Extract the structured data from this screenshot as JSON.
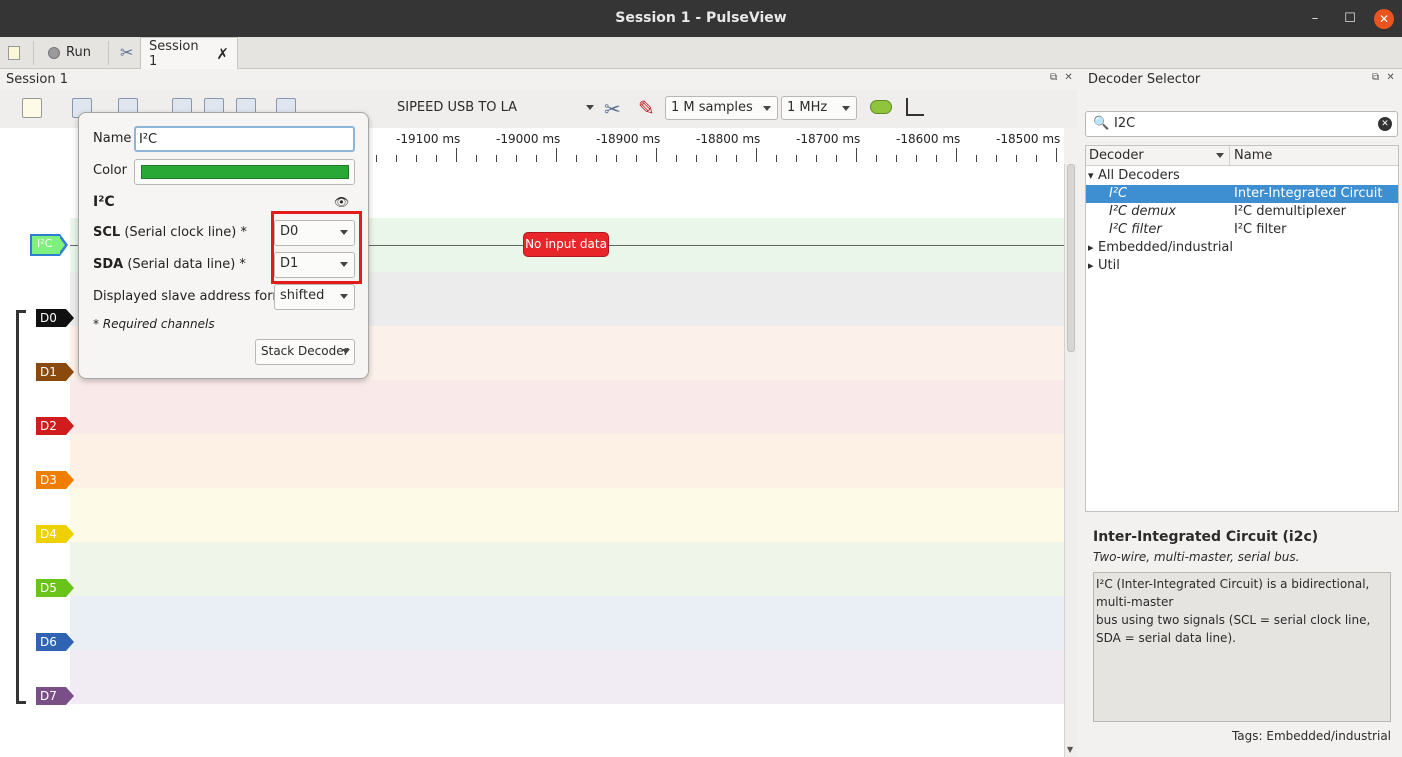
{
  "window": {
    "title": "Session 1 - PulseView",
    "min": "–",
    "max": "☐",
    "close": "✕"
  },
  "tabbar": {
    "run_label": "Run",
    "session_tab": "Session 1",
    "session_close": "✗"
  },
  "session_pane": {
    "title": "Session 1"
  },
  "toolbar": {
    "device": "SIPEED USB TO LA",
    "samples": "1 M samples",
    "rate": "1 MHz"
  },
  "ruler": {
    "ticks": [
      "-19100 ms",
      "-19000 ms",
      "-18900 ms",
      "-18800 ms",
      "-18700 ms",
      "-18600 ms",
      "-18500 ms"
    ]
  },
  "decoder_trace": {
    "label": "I²C",
    "message": "No input data"
  },
  "channels": [
    {
      "label": "D0",
      "color": "#101010",
      "lane": "#ececec"
    },
    {
      "label": "D1",
      "color": "#8a4a0d",
      "lane": "#fbf1ea"
    },
    {
      "label": "D2",
      "color": "#d01c1c",
      "lane": "#fae9e9"
    },
    {
      "label": "D3",
      "color": "#f07d00",
      "lane": "#fdf0e4"
    },
    {
      "label": "D4",
      "color": "#eed000",
      "lane": "#fdfbe8"
    },
    {
      "label": "D5",
      "color": "#6ac318",
      "lane": "#eff6e9"
    },
    {
      "label": "D6",
      "color": "#2f64b2",
      "lane": "#eaeff6"
    },
    {
      "label": "D7",
      "color": "#7a4f88",
      "lane": "#f1ecf3"
    }
  ],
  "popup": {
    "name_label": "Name",
    "name_value": "I²C",
    "color_label": "Color",
    "decoder_title": "I²C",
    "scl_label": "SCL",
    "scl_desc": " (Serial clock line) *",
    "scl_value": "D0",
    "sda_label": "SDA",
    "sda_desc": " (Serial data line) *",
    "sda_value": "D1",
    "format_label": "Displayed slave address format",
    "format_value": "shifted",
    "required_note": "* Required channels",
    "stack_button": "Stack Decoder"
  },
  "decoder_selector": {
    "title": "Decoder Selector",
    "search_value": "I2C",
    "col_decoder": "Decoder",
    "col_name": "Name",
    "rows": [
      {
        "decoder": "All Decoders",
        "name": "",
        "expander": "▾",
        "indent": 0
      },
      {
        "decoder": "I²C",
        "name": "Inter-Integrated Circuit",
        "expander": "",
        "indent": 1,
        "selected": true
      },
      {
        "decoder": "I²C demux",
        "name": "I²C demultiplexer",
        "expander": "",
        "indent": 1
      },
      {
        "decoder": "I²C filter",
        "name": "I²C filter",
        "expander": "",
        "indent": 1
      },
      {
        "decoder": "Embedded/industrial",
        "name": "",
        "expander": "▸",
        "indent": 0
      },
      {
        "decoder": "Util",
        "name": "",
        "expander": "▸",
        "indent": 0
      }
    ],
    "info_title": "Inter-Integrated Circuit (i2c)",
    "info_subtitle": "Two-wire, multi-master, serial bus.",
    "info_text_1": "I²C (Inter-Integrated Circuit) is a bidirectional, multi-master",
    "info_text_2": "bus using two signals (SCL = serial clock line, SDA = serial data line).",
    "tags": "Tags: Embedded/industrial"
  }
}
